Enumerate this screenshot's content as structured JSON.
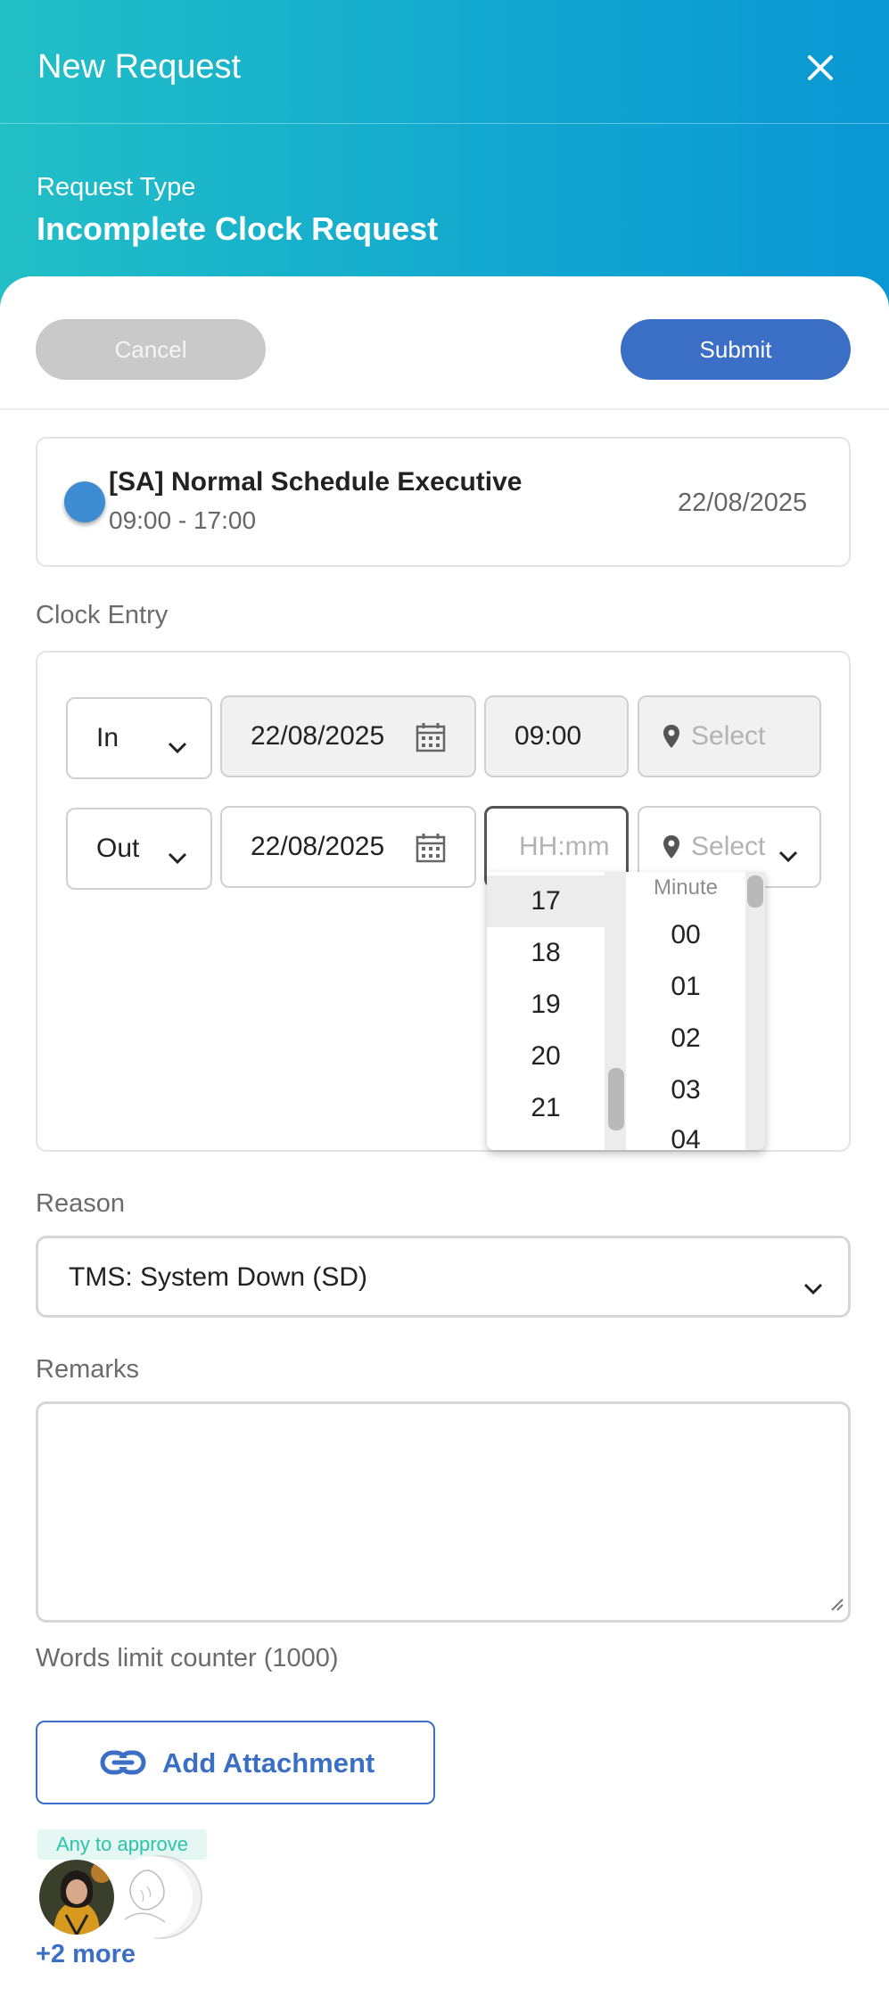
{
  "header": {
    "title": "New Request",
    "request_type_label": "Request Type",
    "request_type_value": "Incomplete Clock Request"
  },
  "actions": {
    "cancel_label": "Cancel",
    "submit_label": "Submit"
  },
  "schedule": {
    "name": "[SA] Normal Schedule Executive",
    "time": "09:00 - 17:00",
    "date": "22/08/2025"
  },
  "clock_entry": {
    "label": "Clock Entry",
    "rows": [
      {
        "type": "In",
        "date": "22/08/2025",
        "time": "09:00",
        "location_placeholder": "Select"
      },
      {
        "type": "Out",
        "date": "22/08/2025",
        "time_placeholder": "HH:mm",
        "location_placeholder": "Select"
      }
    ]
  },
  "time_picker": {
    "hours": [
      "17",
      "18",
      "19",
      "20",
      "21"
    ],
    "selected_hour": "17",
    "minute_header": "Minute",
    "minutes": [
      "00",
      "01",
      "02",
      "03",
      "04"
    ]
  },
  "reason": {
    "label": "Reason",
    "value": "TMS: System Down (SD)"
  },
  "remarks": {
    "label": "Remarks",
    "counter": "Words limit counter (1000)"
  },
  "attachment": {
    "label": "Add Attachment"
  },
  "approvers": {
    "badge": "Any to approve",
    "more": "+2 more"
  },
  "colors": {
    "header_start": "#22bfc6",
    "header_end": "#0a97d4",
    "primary": "#3b6fc6",
    "cancel": "#c9c9c9",
    "approve_badge_text": "#2cc3a8"
  },
  "icons": [
    "close-icon",
    "calendar-icon",
    "chevron-down-icon",
    "location-pin-icon",
    "link-icon",
    "resize-grip-icon"
  ]
}
